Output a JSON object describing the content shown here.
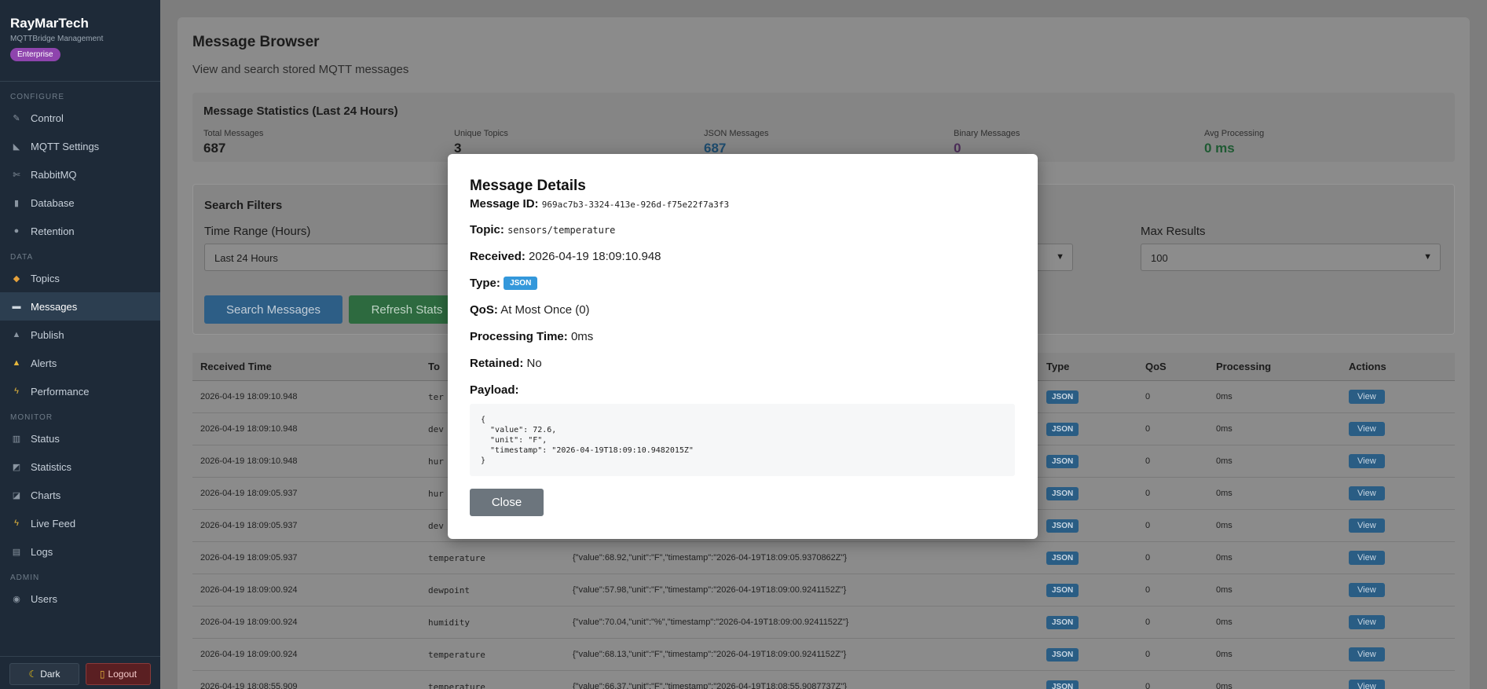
{
  "brand": {
    "name": "RayMarTech",
    "subtitle": "MQTTBridge Management",
    "edition": "Enterprise"
  },
  "sidebar": {
    "configure_label": "CONFIGURE",
    "configure": [
      {
        "label": "Control",
        "icon": "wrench-icon"
      },
      {
        "label": "MQTT Settings",
        "icon": "antenna-icon"
      },
      {
        "label": "RabbitMQ",
        "icon": "rabbit-icon"
      },
      {
        "label": "Database",
        "icon": "database-icon"
      },
      {
        "label": "Retention",
        "icon": "clock-icon"
      }
    ],
    "data_label": "DATA",
    "data": [
      {
        "label": "Topics",
        "icon": "tag-icon"
      },
      {
        "label": "Messages",
        "icon": "message-icon"
      },
      {
        "label": "Publish",
        "icon": "upload-icon"
      },
      {
        "label": "Alerts",
        "icon": "bell-icon"
      },
      {
        "label": "Performance",
        "icon": "bolt-icon"
      }
    ],
    "monitor_label": "MONITOR",
    "monitor": [
      {
        "label": "Status",
        "icon": "bar-chart-icon"
      },
      {
        "label": "Statistics",
        "icon": "trend-icon"
      },
      {
        "label": "Charts",
        "icon": "chart-icon"
      },
      {
        "label": "Live Feed",
        "icon": "lightning-icon"
      },
      {
        "label": "Logs",
        "icon": "log-icon"
      }
    ],
    "admin_label": "ADMIN",
    "admin": [
      {
        "label": "Users",
        "icon": "users-icon"
      }
    ],
    "dark_label": "Dark",
    "logout_label": "Logout"
  },
  "page": {
    "title": "Message Browser",
    "subtitle": "View and search stored MQTT messages"
  },
  "stats": {
    "title": "Message Statistics (Last 24 Hours)",
    "items": [
      {
        "label": "Total Messages",
        "value": "687"
      },
      {
        "label": "Unique Topics",
        "value": "3"
      },
      {
        "label": "JSON Messages",
        "value": "687"
      },
      {
        "label": "Binary Messages",
        "value": "0"
      },
      {
        "label": "Avg Processing",
        "value": "0 ms"
      }
    ]
  },
  "filters": {
    "title": "Search Filters",
    "time_range_label": "Time Range (Hours)",
    "time_range_value": "Last 24 Hours",
    "max_results_label": "Max Results",
    "max_results_value": "100",
    "search_button": "Search Messages",
    "refresh_button": "Refresh Stats"
  },
  "table": {
    "headers": {
      "time": "Received Time",
      "topic": "To",
      "type": "Type",
      "qos": "QoS",
      "processing": "Processing",
      "actions": "Actions"
    },
    "rows": [
      {
        "time": "2026-04-19 18:09:10.948",
        "topic": "ter",
        "payload": "",
        "type": "JSON",
        "qos": "0",
        "proc": "0ms",
        "action": "View"
      },
      {
        "time": "2026-04-19 18:09:10.948",
        "topic": "dev",
        "payload": "",
        "type": "JSON",
        "qos": "0",
        "proc": "0ms",
        "action": "View"
      },
      {
        "time": "2026-04-19 18:09:10.948",
        "topic": "hur",
        "payload": "",
        "type": "JSON",
        "qos": "0",
        "proc": "0ms",
        "action": "View"
      },
      {
        "time": "2026-04-19 18:09:05.937",
        "topic": "hur",
        "payload": "",
        "type": "JSON",
        "qos": "0",
        "proc": "0ms",
        "action": "View"
      },
      {
        "time": "2026-04-19 18:09:05.937",
        "topic": "dev",
        "payload": "",
        "type": "JSON",
        "qos": "0",
        "proc": "0ms",
        "action": "View"
      },
      {
        "time": "2026-04-19 18:09:05.937",
        "topic": "temperature",
        "payload": "{\"value\":68.92,\"unit\":\"F\",\"timestamp\":\"2026-04-19T18:09:05.9370862Z\"}",
        "type": "JSON",
        "qos": "0",
        "proc": "0ms",
        "action": "View"
      },
      {
        "time": "2026-04-19 18:09:00.924",
        "topic": "dewpoint",
        "payload": "{\"value\":57.98,\"unit\":\"F\",\"timestamp\":\"2026-04-19T18:09:00.9241152Z\"}",
        "type": "JSON",
        "qos": "0",
        "proc": "0ms",
        "action": "View"
      },
      {
        "time": "2026-04-19 18:09:00.924",
        "topic": "humidity",
        "payload": "{\"value\":70.04,\"unit\":\"%\",\"timestamp\":\"2026-04-19T18:09:00.9241152Z\"}",
        "type": "JSON",
        "qos": "0",
        "proc": "0ms",
        "action": "View"
      },
      {
        "time": "2026-04-19 18:09:00.924",
        "topic": "temperature",
        "payload": "{\"value\":68.13,\"unit\":\"F\",\"timestamp\":\"2026-04-19T18:09:00.9241152Z\"}",
        "type": "JSON",
        "qos": "0",
        "proc": "0ms",
        "action": "View"
      },
      {
        "time": "2026-04-19 18:08:55.909",
        "topic": "temperature",
        "payload": "{\"value\":66.37,\"unit\":\"F\",\"timestamp\":\"2026-04-19T18:08:55.9087737Z\"}",
        "type": "JSON",
        "qos": "0",
        "proc": "0ms",
        "action": "View"
      }
    ]
  },
  "modal": {
    "title": "Message Details",
    "id_label": "Message ID:",
    "id_value": "969ac7b3-3324-413e-926d-f75e22f7a3f3",
    "topic_label": "Topic:",
    "topic_value": "sensors/temperature",
    "received_label": "Received:",
    "received_value": "2026-04-19 18:09:10.948",
    "type_label": "Type:",
    "type_value": "JSON",
    "qos_label": "QoS:",
    "qos_value": "At Most Once (0)",
    "proc_label": "Processing Time:",
    "proc_value": "0ms",
    "retained_label": "Retained:",
    "retained_value": "No",
    "payload_label": "Payload:",
    "payload_value": "{\n  \"value\": 72.6,\n  \"unit\": \"F\",\n  \"timestamp\": \"2026-04-19T18:09:10.9482015Z\"\n}",
    "close_button": "Close"
  },
  "colors": {
    "accent": "#3498db",
    "enterprise": "#8e44ad",
    "close": "#6c757d"
  }
}
